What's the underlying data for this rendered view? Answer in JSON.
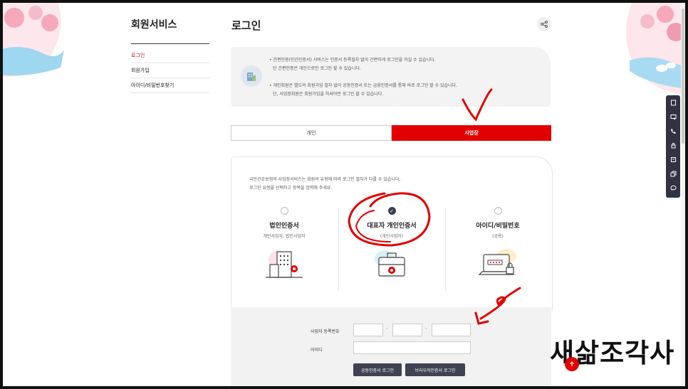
{
  "sidebar": {
    "title": "회원서비스",
    "items": [
      {
        "label": "로그인",
        "active": true
      },
      {
        "label": "회원가입",
        "active": false
      },
      {
        "label": "아이디/비밀번호찾기",
        "active": false
      }
    ]
  },
  "page": {
    "title": "로그인"
  },
  "notice": {
    "lines": [
      "• 간편인증(민간인증서) 서비스는 인증서 등록절차 없이 간편하게 로그인을 하실 수 있습니다.",
      "단 간편인증은 개인으로만 로그인 할 수 있습니다.",
      "• 개인회원은 별도의 회원가입 절차 없이 공동인증서 또는 금융인증서를 통해 바로 로그인 할 수 있습니다.",
      "단, 사업장회원은 회원가입을 하셔야만 로그인 할 수 있습니다."
    ]
  },
  "tabs": [
    {
      "label": "개인",
      "active": false
    },
    {
      "label": "사업장",
      "active": true
    }
  ],
  "panel": {
    "desc_lines": [
      "국민건강보험의 사업장서비스는 회원의 유형에 따라 로그인 절차가 다를 수 있습니다.",
      "로그인 유형을 선택하고 항목을 입력해 주세요."
    ],
    "options": [
      {
        "title": "법인인증서",
        "sub": "개인사업자, 법인사업자",
        "selected": false
      },
      {
        "title": "대표자 개인인증서",
        "sub": "(개인사업자)",
        "selected": true
      },
      {
        "title": "아이디/비밀번호",
        "sub": "(공용)",
        "selected": false
      }
    ]
  },
  "form": {
    "biz_label": "사업자 등록번호",
    "id_label": "아이디",
    "dash": "-",
    "btn_joint": "공동인증서 로그인",
    "btn_browser": "브라우저인증서 로그인"
  },
  "watermark": "새삶조각사",
  "colors": {
    "accent": "#e30000",
    "dark": "#3f4252",
    "annotation": "#e00000"
  },
  "quickmenu_icons": [
    "document-icon",
    "certificate-icon",
    "phone-icon",
    "lock-icon",
    "news-icon",
    "copy-icon",
    "chat-icon"
  ]
}
